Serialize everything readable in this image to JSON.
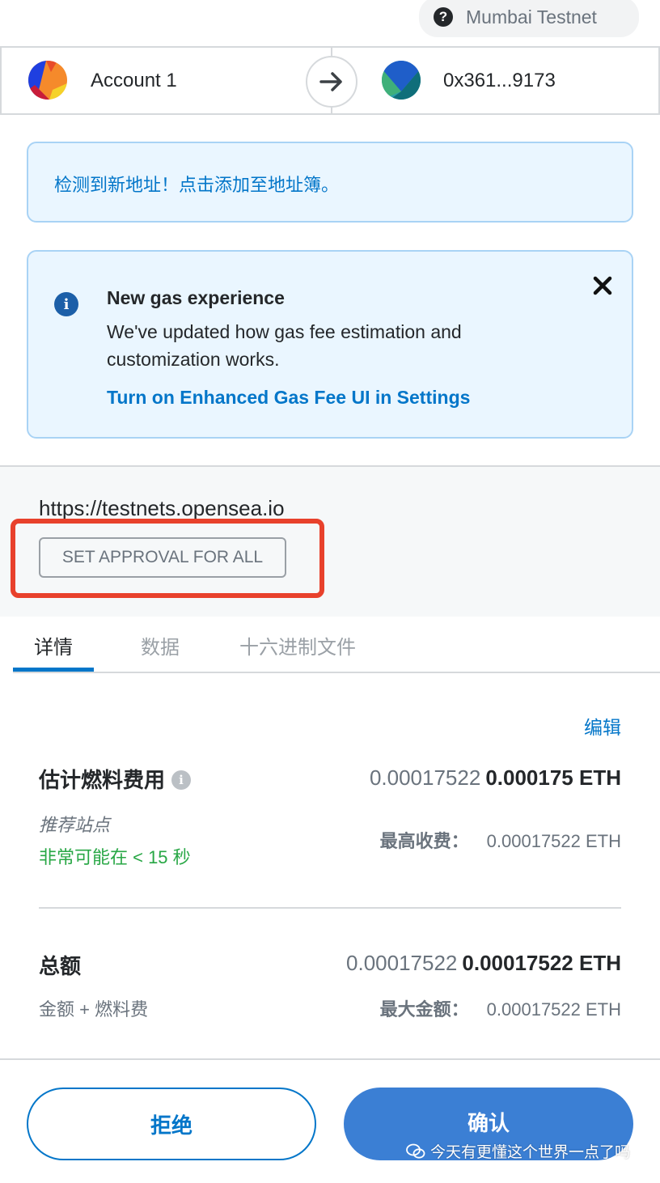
{
  "network": {
    "help_icon": "?",
    "name": "Mumbai Testnet"
  },
  "accounts": {
    "from_name": "Account 1",
    "to_address": "0x361...9173"
  },
  "notices": {
    "new_address": "检测到新地址！点击添加至地址簿。",
    "gas_title": "New gas experience",
    "gas_body": "We've updated how gas fee estimation and customization works.",
    "gas_link": "Turn on Enhanced Gas Fee UI in Settings",
    "info_glyph": "i"
  },
  "origin": {
    "url": "https://testnets.opensea.io",
    "method": "SET APPROVAL FOR ALL"
  },
  "tabs": [
    {
      "label": "详情",
      "active": true
    },
    {
      "label": "数据",
      "active": false
    },
    {
      "label": "十六进制文件",
      "active": false
    }
  ],
  "details": {
    "edit_label": "编辑",
    "gas": {
      "title": "估计燃料费用",
      "info_glyph": "i",
      "secondary_value": "0.00017522",
      "primary_value": "0.000175 ETH",
      "site_suggested": "推荐站点",
      "likelihood": "非常可能在 < 15 秒",
      "max_label": "最高收费：",
      "max_value": "0.00017522 ETH"
    },
    "total": {
      "title": "总额",
      "secondary_value": "0.00017522",
      "primary_value": "0.00017522 ETH",
      "subtitle": "金额 + 燃料费",
      "max_label": "最大金额：",
      "max_value": "0.00017522 ETH"
    }
  },
  "actions": {
    "reject_label": "拒绝",
    "confirm_label": "确认"
  },
  "watermark": "今天有更懂这个世界一点了吗",
  "colors": {
    "primary_blue": "#0376c9",
    "highlight_red": "#e8412c",
    "success_green": "#28a745"
  }
}
